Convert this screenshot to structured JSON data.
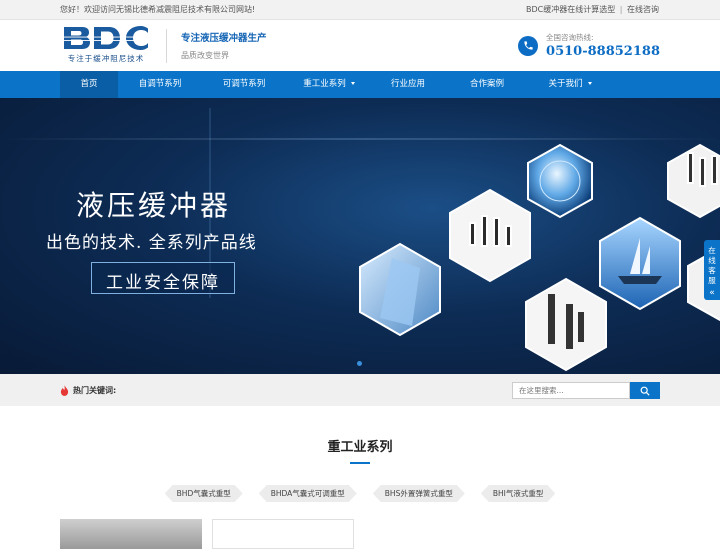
{
  "topbar": {
    "welcome": "您好！欢迎访问无锡比德希减震阻尼技术有限公司网站!",
    "link_calc": "BDC缓冲器在线计算选型",
    "link_separator": "|",
    "link_consult": "在线咨询"
  },
  "header": {
    "logo_text": "BDC",
    "logo_sub": "专注于缓冲阻尼技术",
    "slogan_main": "专注液压缓冲器生产",
    "slogan_sub": "品质改变世界",
    "hotline_label": "全国咨询热线:",
    "hotline_number": "0510-88852188"
  },
  "nav": [
    {
      "label": "首页",
      "active": true,
      "dropdown": false
    },
    {
      "label": "自调节系列",
      "active": false,
      "dropdown": false
    },
    {
      "label": "可调节系列",
      "active": false,
      "dropdown": false
    },
    {
      "label": "重工业系列",
      "active": false,
      "dropdown": true
    },
    {
      "label": "行业应用",
      "active": false,
      "dropdown": false
    },
    {
      "label": "合作案例",
      "active": false,
      "dropdown": false
    },
    {
      "label": "关于我们",
      "active": false,
      "dropdown": true
    }
  ],
  "banner": {
    "title": "液压缓冲器",
    "subtitle": "出色的技术. 全系列产品线",
    "tagline": "工业安全保障"
  },
  "side_tab": {
    "label": "在线客服",
    "arrow": "«"
  },
  "search": {
    "hot_label": "热门关键词:",
    "placeholder": "在这里搜索..."
  },
  "section": {
    "title": "重工业系列",
    "tags": [
      "BHD气囊式重型",
      "BHDA气囊式可调重型",
      "BHS外置弹簧式重型",
      "BHI气液式重型"
    ]
  },
  "colors": {
    "primary": "#0b74c8",
    "nav_active": "#0a5ea6",
    "banner_dark": "#081a36"
  },
  "icons": {
    "phone": "phone-icon",
    "fire": "fire-icon",
    "search": "search-icon"
  }
}
